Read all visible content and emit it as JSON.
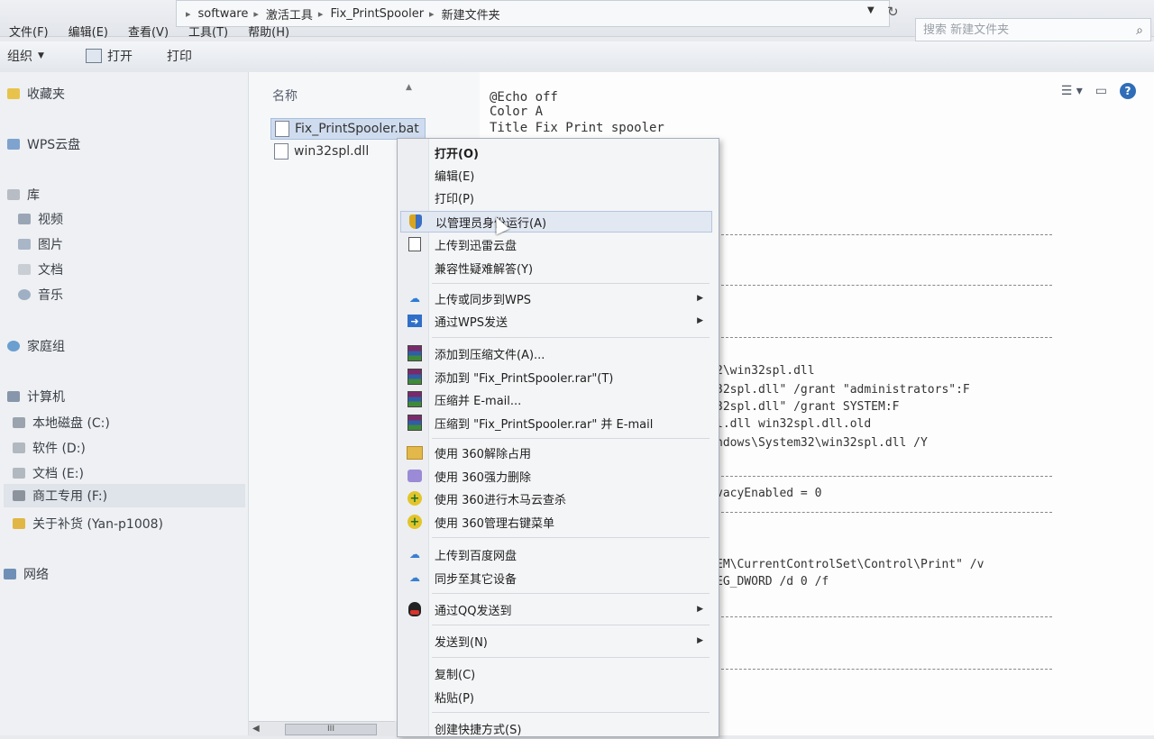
{
  "address": {
    "crumbs": [
      "software",
      "激活工具",
      "Fix_PrintSpooler",
      "新建文件夹"
    ],
    "search_placeholder": "搜索 新建文件夹"
  },
  "menubar": [
    "文件(F)",
    "编辑(E)",
    "查看(V)",
    "工具(T)",
    "帮助(H)"
  ],
  "toolbar": {
    "organize": "组织",
    "open": "打开",
    "print": "打印"
  },
  "nav": {
    "favorites": "收藏夹",
    "wps_cloud": "WPS云盘",
    "libraries": "库",
    "lib_items": [
      "视频",
      "图片",
      "文档",
      "音乐"
    ],
    "homegroup": "家庭组",
    "computer": "计算机",
    "drives": [
      "本地磁盘 (C:)",
      "软件 (D:)",
      "文档 (E:)",
      "商工专用 (F:)",
      "关于补货 (Yan-p1008)"
    ],
    "network": "网络"
  },
  "files": {
    "column_name": "名称",
    "items": [
      "Fix_PrintSpooler.bat",
      "win32spl.dll"
    ]
  },
  "preview": {
    "head_lines": [
      "@Echo off",
      "Color A",
      "Title Fix Print spooler"
    ],
    "body_lines": [
      "2\\win32spl.dll",
      "32spl.dll\" /grant \"administrators\":F",
      "32spl.dll\" /grant SYSTEM:F",
      "l.dll win32spl.dll.old",
      "ndows\\System32\\win32spl.dll /Y",
      "vacyEnabled = 0",
      "EM\\CurrentControlSet\\Control\\Print\" /v",
      "EG_DWORD /d 0 /f"
    ]
  },
  "context_menu": {
    "open": "打开(O)",
    "edit": "编辑(E)",
    "print": "打印(P)",
    "run_as_admin": "以管理员身份运行(A)",
    "upload_xunlei": "上传到迅雷云盘",
    "compat": "兼容性疑难解答(Y)",
    "wps_sync": "上传或同步到WPS",
    "wps_send": "通过WPS发送",
    "rar_add": "添加到压缩文件(A)...",
    "rar_add_named": "添加到 \"Fix_PrintSpooler.rar\"(T)",
    "rar_email": "压缩并 E-mail...",
    "rar_named_email": "压缩到 \"Fix_PrintSpooler.rar\" 并 E-mail",
    "u360_unlock": "使用 360解除占用",
    "u360_delete": "使用 360强力删除",
    "u360_scan": "使用 360进行木马云查杀",
    "u360_menu": "使用 360管理右键菜单",
    "baidu_upload": "上传到百度网盘",
    "sync_devices": "同步至其它设备",
    "qq_send": "通过QQ发送到",
    "send_to": "发送到(N)",
    "copy": "复制(C)",
    "paste": "粘贴(P)",
    "shortcut": "创建快捷方式(S)"
  },
  "scroll": {
    "thumb": "III"
  }
}
